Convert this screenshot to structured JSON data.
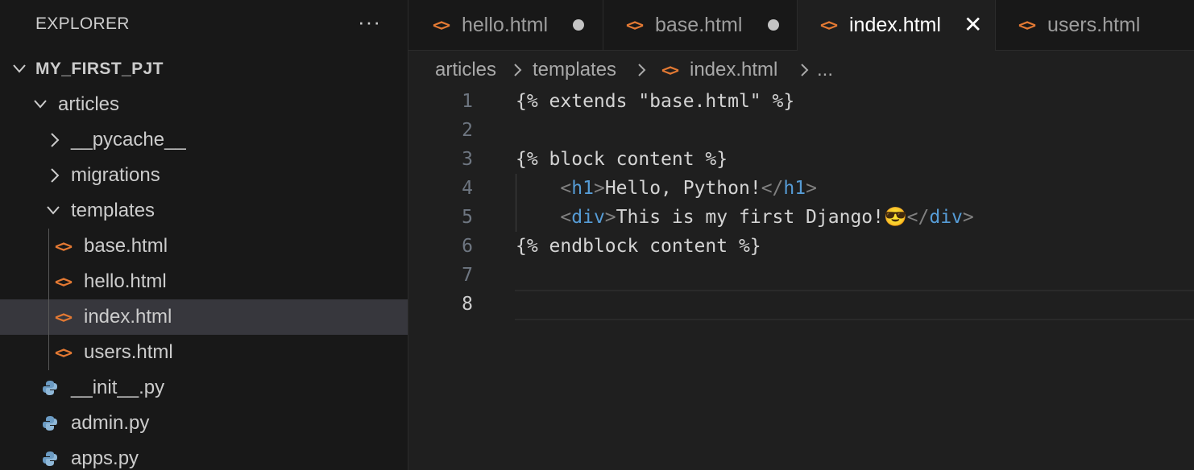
{
  "sidebar": {
    "title": "EXPLORER",
    "more": "···",
    "project": "MY_FIRST_PJT",
    "items": [
      {
        "label": "articles"
      },
      {
        "label": "__pycache__"
      },
      {
        "label": "migrations"
      },
      {
        "label": "templates"
      },
      {
        "label": "base.html"
      },
      {
        "label": "hello.html"
      },
      {
        "label": "index.html"
      },
      {
        "label": "users.html"
      },
      {
        "label": "__init__.py"
      },
      {
        "label": "admin.py"
      },
      {
        "label": "apps.py"
      }
    ]
  },
  "tabs": [
    {
      "label": "hello.html",
      "modified": true
    },
    {
      "label": "base.html",
      "modified": true
    },
    {
      "label": "index.html",
      "active": true
    },
    {
      "label": "users.html"
    }
  ],
  "breadcrumb": {
    "parts": [
      "articles",
      "templates",
      "index.html",
      "..."
    ]
  },
  "editor": {
    "line_numbers": [
      "1",
      "2",
      "3",
      "4",
      "5",
      "6",
      "7",
      "8"
    ],
    "current_line": 8,
    "lines": [
      "{% extends \"base.html\" %}",
      "",
      "{% block content %}",
      "    <h1>Hello, Python!</h1>",
      "    <div>This is my first Django!😎</div>",
      "{% endblock content %}",
      "",
      ""
    ]
  },
  "colors": {
    "html_icon": "#e37933",
    "tag": "#569cd6",
    "selection": "#37373d"
  },
  "icons": {
    "chevron_down": "chevron-down-icon",
    "chevron_right": "chevron-right-icon",
    "html_file": "html-file-icon",
    "python_file": "python-file-icon",
    "close": "close-icon",
    "modified_dot": "modified-dot-icon"
  }
}
